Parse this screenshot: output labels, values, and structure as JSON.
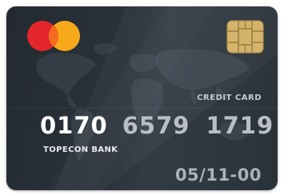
{
  "card": {
    "label": "CREDIT CARD",
    "number_groups": [
      "0170",
      "6579",
      "1719"
    ],
    "bank_name": "TOPECON BANK",
    "expiry": "05/11-00"
  },
  "colors": {
    "card_background": "#2a3239",
    "logo_left_circle": "#e2262b",
    "logo_right_circle": "#f7a81b",
    "chip": "#d4b46b"
  },
  "icons": {
    "logo": "mastercard-style-logo",
    "chip": "emv-chip",
    "background": "world-map"
  }
}
